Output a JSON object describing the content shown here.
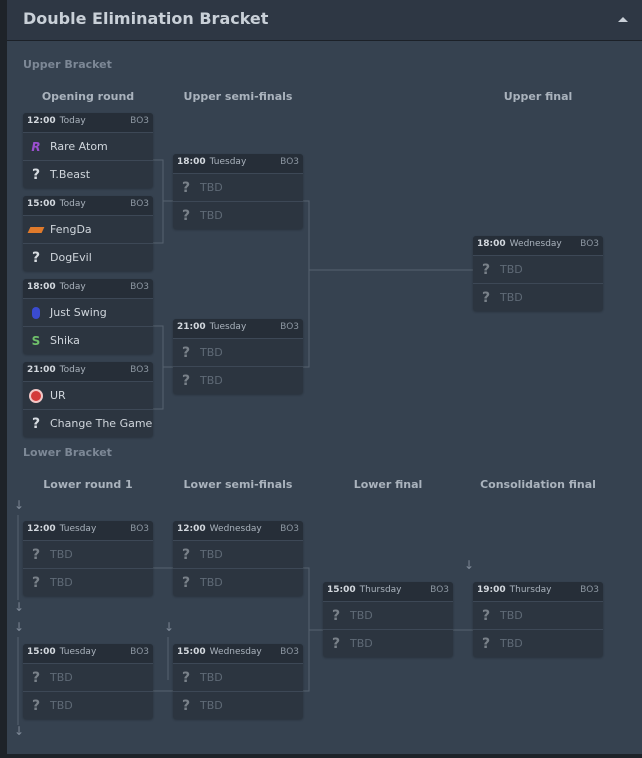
{
  "title": "Double Elimination Bracket",
  "upper": {
    "label": "Upper Bracket",
    "columns": [
      "Opening round",
      "Upper semi-finals",
      "Upper final"
    ]
  },
  "lower": {
    "label": "Lower Bracket",
    "columns": [
      "Lower round 1",
      "Lower semi-finals",
      "Lower final",
      "Consolidation final"
    ]
  },
  "matches": [
    {
      "time": "12:00",
      "day": "Today",
      "format": "BO3",
      "teams": [
        {
          "name": "Rare Atom",
          "icon": "rare-atom-logo"
        },
        {
          "name": "T.Beast",
          "icon": "question-icon"
        }
      ]
    },
    {
      "time": "15:00",
      "day": "Today",
      "format": "BO3",
      "teams": [
        {
          "name": "FengDa",
          "icon": "fengda-logo"
        },
        {
          "name": "DogEvil",
          "icon": "question-icon"
        }
      ]
    },
    {
      "time": "18:00",
      "day": "Today",
      "format": "BO3",
      "teams": [
        {
          "name": "Just Swing",
          "icon": "just-swing-logo"
        },
        {
          "name": "Shika",
          "icon": "shika-logo"
        }
      ]
    },
    {
      "time": "21:00",
      "day": "Today",
      "format": "BO3",
      "teams": [
        {
          "name": "UR",
          "icon": "ur-logo"
        },
        {
          "name": "Change The Game",
          "icon": "question-icon"
        }
      ]
    },
    {
      "time": "18:00",
      "day": "Tuesday",
      "format": "BO3",
      "teams": [
        {
          "name": "TBD"
        },
        {
          "name": "TBD"
        }
      ]
    },
    {
      "time": "21:00",
      "day": "Tuesday",
      "format": "BO3",
      "teams": [
        {
          "name": "TBD"
        },
        {
          "name": "TBD"
        }
      ]
    },
    {
      "time": "18:00",
      "day": "Wednesday",
      "format": "BO3",
      "teams": [
        {
          "name": "TBD"
        },
        {
          "name": "TBD"
        }
      ]
    },
    {
      "time": "12:00",
      "day": "Tuesday",
      "format": "BO3",
      "teams": [
        {
          "name": "TBD"
        },
        {
          "name": "TBD"
        }
      ]
    },
    {
      "time": "15:00",
      "day": "Tuesday",
      "format": "BO3",
      "teams": [
        {
          "name": "TBD"
        },
        {
          "name": "TBD"
        }
      ]
    },
    {
      "time": "12:00",
      "day": "Wednesday",
      "format": "BO3",
      "teams": [
        {
          "name": "TBD"
        },
        {
          "name": "TBD"
        }
      ]
    },
    {
      "time": "15:00",
      "day": "Wednesday",
      "format": "BO3",
      "teams": [
        {
          "name": "TBD"
        },
        {
          "name": "TBD"
        }
      ]
    },
    {
      "time": "15:00",
      "day": "Thursday",
      "format": "BO3",
      "teams": [
        {
          "name": "TBD"
        },
        {
          "name": "TBD"
        }
      ]
    },
    {
      "time": "19:00",
      "day": "Thursday",
      "format": "BO3",
      "teams": [
        {
          "name": "TBD"
        },
        {
          "name": "TBD"
        }
      ]
    }
  ],
  "colors": {
    "background": "#364250",
    "card": "#2c3540",
    "header": "#2e3744"
  }
}
